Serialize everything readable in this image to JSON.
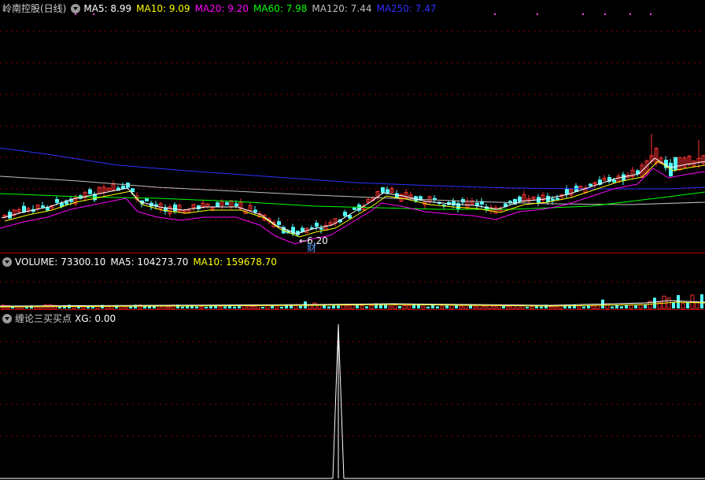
{
  "stock_title": "岭南控股(日线)",
  "price_legend": {
    "ma5": {
      "label": "MA5: 8.99",
      "color": "#ffffff"
    },
    "ma10": {
      "label": "MA10: 9.09",
      "color": "#ffff00"
    },
    "ma20": {
      "label": "MA20: 9.20",
      "color": "#ff00ff"
    },
    "ma60": {
      "label": "MA60: 7.98",
      "color": "#00ff00"
    },
    "ma120": {
      "label": "MA120: 7.44",
      "color": "#c0c0c0"
    },
    "ma250": {
      "label": "MA250: 7.47",
      "color": "#3030ff"
    }
  },
  "low_marker_text": "6.20",
  "event_marker_text": "财",
  "volume_legend": {
    "volume": {
      "label": "VOLUME: 73300.10",
      "color": "#ffffff"
    },
    "ma5": {
      "label": "MA5: 104273.70",
      "color": "#ffffff"
    },
    "ma10": {
      "label": "MA10: 159678.70",
      "color": "#ffff00"
    }
  },
  "indicator_legend": {
    "name": "缠论三买买点",
    "xg": "XG: 0.00"
  },
  "colors": {
    "up": "#ff3232",
    "down": "#54ffff",
    "grid": "#8b0000",
    "panel_border": "#c00000",
    "signal": "#ffffff"
  },
  "icons": [
    "collapse-caret-icon"
  ],
  "chart_data": {
    "type": "candlestick",
    "title": "岭南控股(日线)",
    "moving_averages": [
      {
        "name": "MA5",
        "value": 8.99
      },
      {
        "name": "MA10",
        "value": 9.09
      },
      {
        "name": "MA20",
        "value": 9.2
      },
      {
        "name": "MA60",
        "value": 7.98
      },
      {
        "name": "MA120",
        "value": 7.44
      },
      {
        "name": "MA250",
        "value": 7.47
      }
    ],
    "marked_low": 6.2,
    "volume": {
      "last": 73300.1,
      "ma5": 104273.7,
      "ma10": 159678.7
    },
    "indicator": {
      "name": "缠论三买买点",
      "xg_last": 0.0,
      "signal_count": 1
    }
  }
}
